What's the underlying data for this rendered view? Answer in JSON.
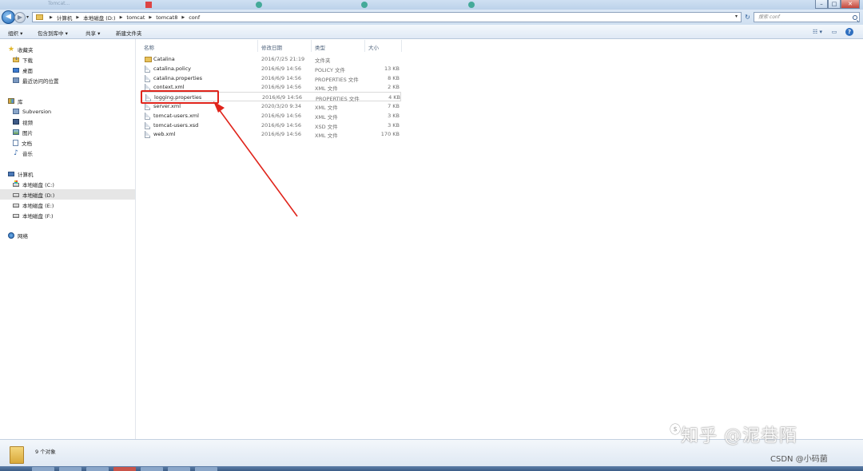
{
  "window": {
    "ghost_tabs": [
      "Tomcat...",
      "",
      "",
      "",
      ""
    ],
    "controls": {
      "minimize": "–",
      "maximize": "□",
      "close": "✕"
    }
  },
  "address_bar": {
    "back_glyph": "◀",
    "forward_glyph": "▶",
    "dropdown_glyph": "▾",
    "breadcrumbs": [
      "计算机",
      "本地磁盘 (D:)",
      "tomcat",
      "tomcat8",
      "conf"
    ],
    "refresh_glyph": "↻",
    "search_placeholder": "搜索 conf"
  },
  "toolbar": {
    "organize": "组织 ▾",
    "include_in_library": "包含到库中 ▾",
    "share": "共享 ▾",
    "new_folder": "新建文件夹",
    "view_glyph": "☷ ▾",
    "preview_glyph": "▭",
    "help_glyph": "?"
  },
  "nav": {
    "favorites": {
      "label": "收藏夹",
      "items": [
        "下载",
        "桌面",
        "最近访问的位置"
      ]
    },
    "libraries": {
      "label": "库",
      "items": [
        "Subversion",
        "视频",
        "图片",
        "文档",
        "音乐"
      ]
    },
    "computer": {
      "label": "计算机",
      "items": [
        "本地磁盘 (C:)",
        "本地磁盘 (D:)",
        "本地磁盘 (E:)",
        "本地磁盘 (F:)"
      ],
      "selected_index": 1
    },
    "network": {
      "label": "网络"
    }
  },
  "columns": {
    "name": "名称",
    "date": "修改日期",
    "type": "类型",
    "size": "大小"
  },
  "files": [
    {
      "name": "Catalina",
      "date": "2016/7/25 21:19",
      "type": "文件夹",
      "size": "",
      "kind": "folder"
    },
    {
      "name": "catalina.policy",
      "date": "2016/6/9 14:56",
      "type": "POLICY 文件",
      "size": "13 KB",
      "kind": "file"
    },
    {
      "name": "catalina.properties",
      "date": "2016/6/9 14:56",
      "type": "PROPERTIES 文件",
      "size": "8 KB",
      "kind": "file"
    },
    {
      "name": "context.xml",
      "date": "2016/6/9 14:56",
      "type": "XML 文件",
      "size": "2 KB",
      "kind": "file"
    },
    {
      "name": "logging.properties",
      "date": "2016/6/9 14:56",
      "type": "PROPERTIES 文件",
      "size": "4 KB",
      "kind": "file",
      "highlighted": true
    },
    {
      "name": "server.xml",
      "date": "2020/3/20 9:34",
      "type": "XML 文件",
      "size": "7 KB",
      "kind": "file"
    },
    {
      "name": "tomcat-users.xml",
      "date": "2016/6/9 14:56",
      "type": "XML 文件",
      "size": "3 KB",
      "kind": "file"
    },
    {
      "name": "tomcat-users.xsd",
      "date": "2016/6/9 14:56",
      "type": "XSD 文件",
      "size": "3 KB",
      "kind": "file"
    },
    {
      "name": "web.xml",
      "date": "2016/6/9 14:56",
      "type": "XML 文件",
      "size": "170 KB",
      "kind": "file"
    }
  ],
  "annotation": {
    "color": "#e0241b"
  },
  "status": {
    "count_text": "9 个对象"
  },
  "watermark": {
    "text": "知乎 @泥巷陌",
    "csdn": "CSDN @小码菌"
  },
  "colors": {
    "accent": "#2f6fc0",
    "selected_nav": "#e6e6e6",
    "folder": "#e8c25a"
  }
}
